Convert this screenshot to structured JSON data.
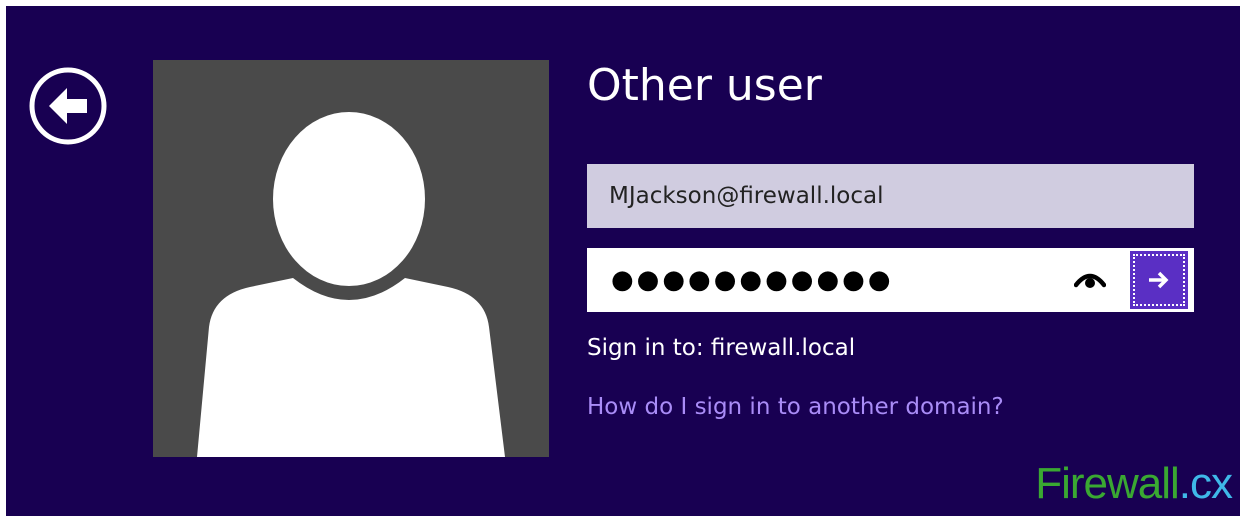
{
  "login": {
    "title": "Other user",
    "username_value": "MJackson@firewall.local",
    "password_masked": "●●●●●●●●●●●",
    "sign_in_to": "Sign in to: firewall.local",
    "help_link": "How do I sign in to another domain?"
  },
  "icons": {
    "back": "arrow-left-circle-icon",
    "reveal": "eye-icon",
    "submit": "arrow-right-icon",
    "avatar": "user-silhouette-icon"
  },
  "watermark": {
    "part1": "Firewall",
    "part2": ".cx"
  },
  "colors": {
    "background": "#180052",
    "avatar_background": "#4a4a4a",
    "username_field": "#d0cce0",
    "submit_button": "#5a2fc4",
    "link": "#a98cf7"
  }
}
